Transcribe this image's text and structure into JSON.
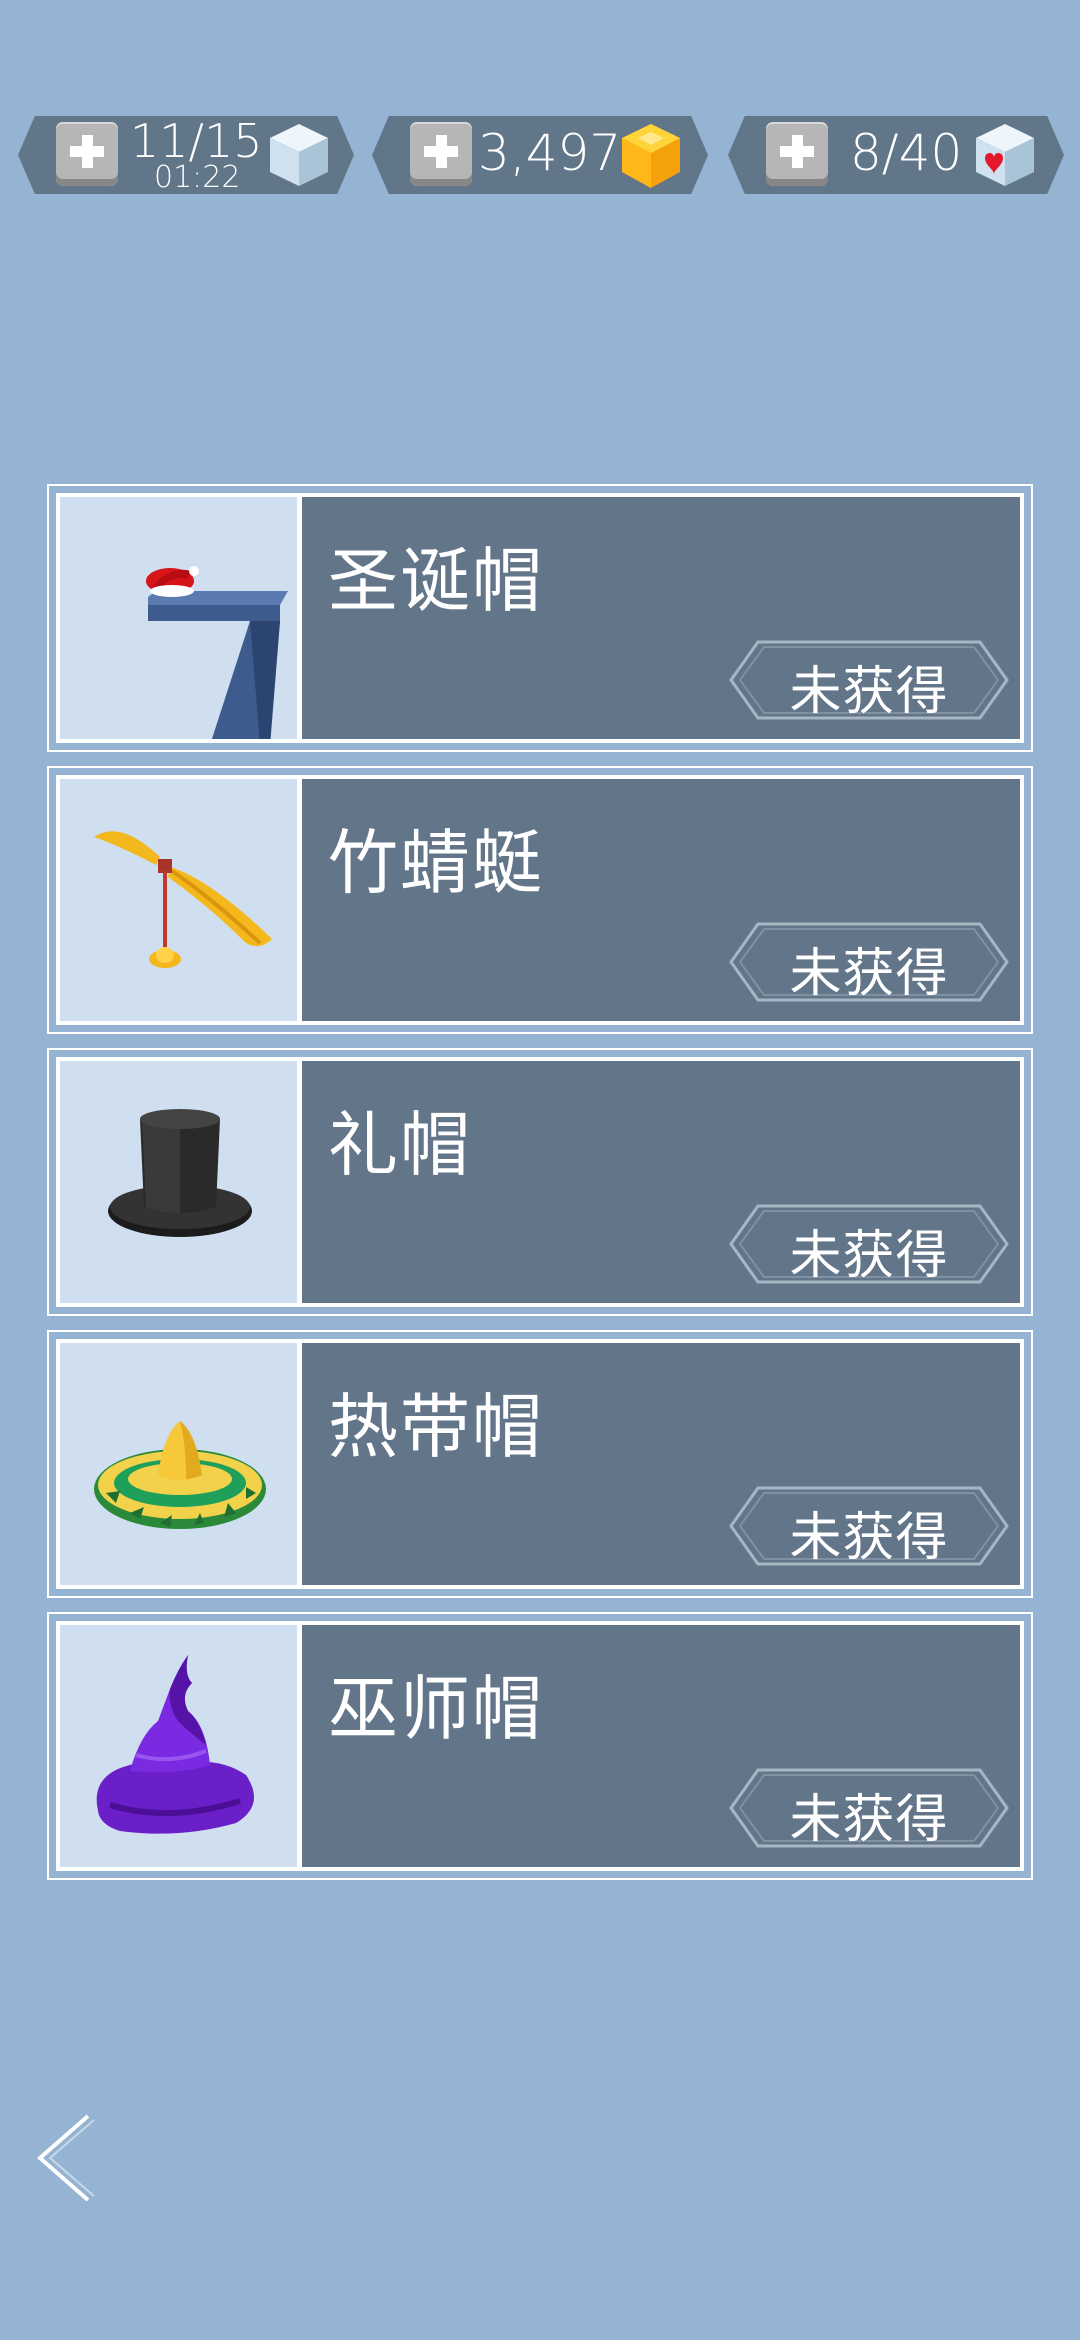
{
  "resources": {
    "energy": {
      "value": "11/15",
      "timer": "01:22",
      "icon": "blue-cube-icon"
    },
    "gold": {
      "value": "3,497",
      "icon": "gold-cube-icon"
    },
    "hearts": {
      "value": "8/40",
      "icon": "heart-cube-icon"
    }
  },
  "hats": [
    {
      "name": "圣诞帽",
      "status": "未获得",
      "icon": "santa-hat-icon"
    },
    {
      "name": "竹蜻蜓",
      "status": "未获得",
      "icon": "bamboo-copter-icon"
    },
    {
      "name": "礼帽",
      "status": "未获得",
      "icon": "top-hat-icon"
    },
    {
      "name": "热带帽",
      "status": "未获得",
      "icon": "sombrero-icon"
    },
    {
      "name": "巫师帽",
      "status": "未获得",
      "icon": "wizard-hat-icon"
    }
  ],
  "colors": {
    "background": "#95b4d3",
    "card": "#627589",
    "thumb": "#cfdff0",
    "pill": "#617688"
  },
  "nav": {
    "back_icon": "back-chevron-icon"
  }
}
